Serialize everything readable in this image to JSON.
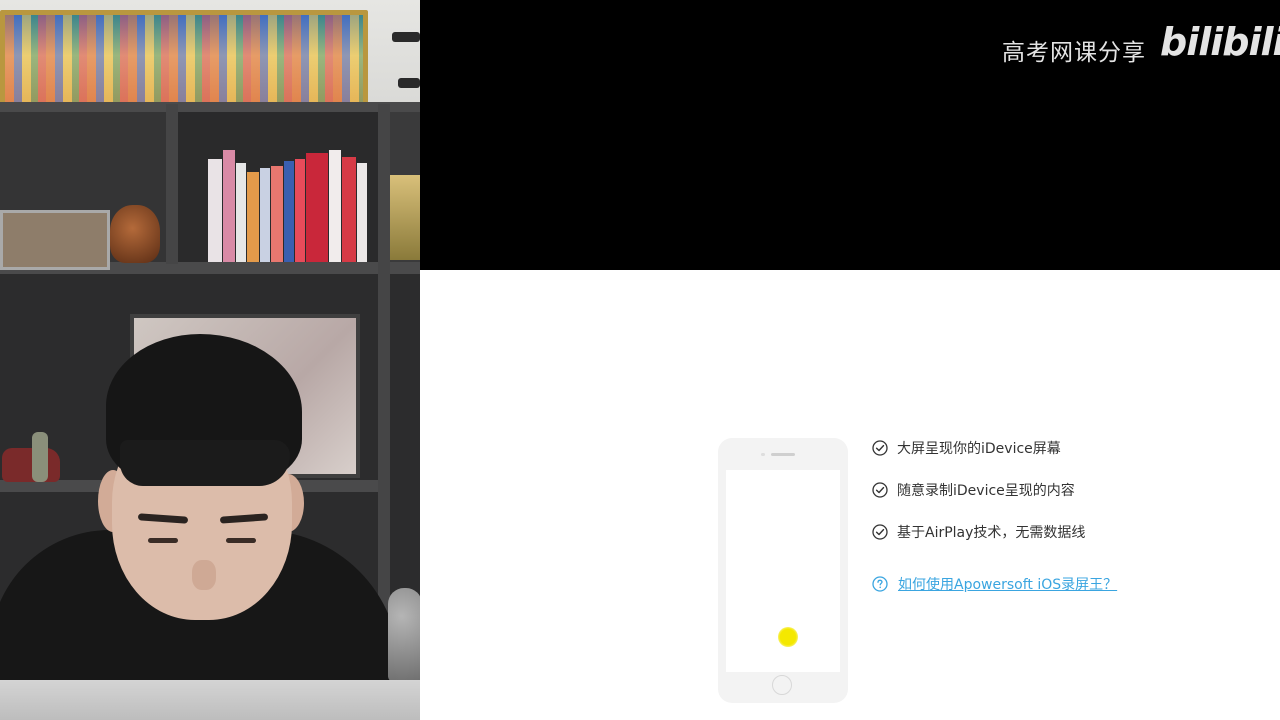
{
  "watermark": {
    "channel": "高考网课分享",
    "logo_text": "bilibili"
  },
  "colors": {
    "top_panel": "#000000",
    "app_background": "#ffffff",
    "feature_text": "#333333",
    "help_link": "#3aa5e0",
    "cursor_highlight": "#f4e800"
  },
  "features": [
    {
      "icon": "check-circle-icon",
      "text": "大屏呈现你的iDevice屏幕"
    },
    {
      "icon": "check-circle-icon",
      "text": "随意录制iDevice呈现的内容"
    },
    {
      "icon": "check-circle-icon",
      "text": "基于AirPlay技术，无需数据线"
    }
  ],
  "help_link": {
    "icon": "question-circle-icon",
    "text": "如何使用Apowersoft iOS录屏王？"
  }
}
